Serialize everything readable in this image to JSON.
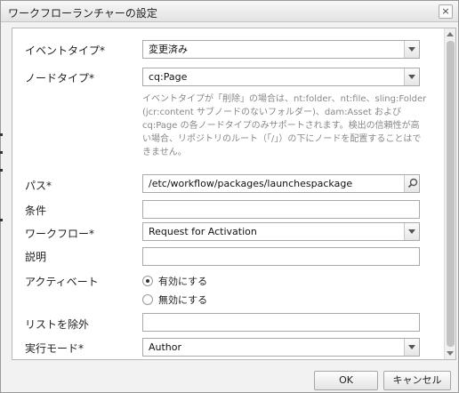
{
  "dialog": {
    "title": "ワークフローランチャーの設定",
    "close_glyph": "×"
  },
  "form": {
    "event_type": {
      "label": "イベントタイプ*",
      "value": "変更済み"
    },
    "node_type": {
      "label": "ノードタイプ*",
      "value": "cq:Page"
    },
    "help_text": "イベントタイプが「削除」の場合は、nt:folder、nt:file、sling:Folder (jcr:content サブノードのないフォルダー)、dam:Asset および cq:Page の各ノードタイプのみサポートされます。検出の信頼性が高い場合、リポジトリのルート（「/」）の下にノードを配置することはできません。",
    "path": {
      "label": "パス*",
      "value": "/etc/workflow/packages/launchespackage"
    },
    "condition": {
      "label": "条件",
      "value": ""
    },
    "workflow": {
      "label": "ワークフロー*",
      "value": "Request for Activation"
    },
    "description": {
      "label": "説明",
      "value": ""
    },
    "activate": {
      "label": "アクティベート",
      "options": [
        "有効にする",
        "無効にする"
      ],
      "selected": "有効にする"
    },
    "exclude_list": {
      "label": "リストを除外",
      "value": ""
    },
    "run_mode": {
      "label": "実行モード*",
      "value": "Author"
    }
  },
  "buttons": {
    "ok": "OK",
    "cancel": "キャンセル"
  }
}
